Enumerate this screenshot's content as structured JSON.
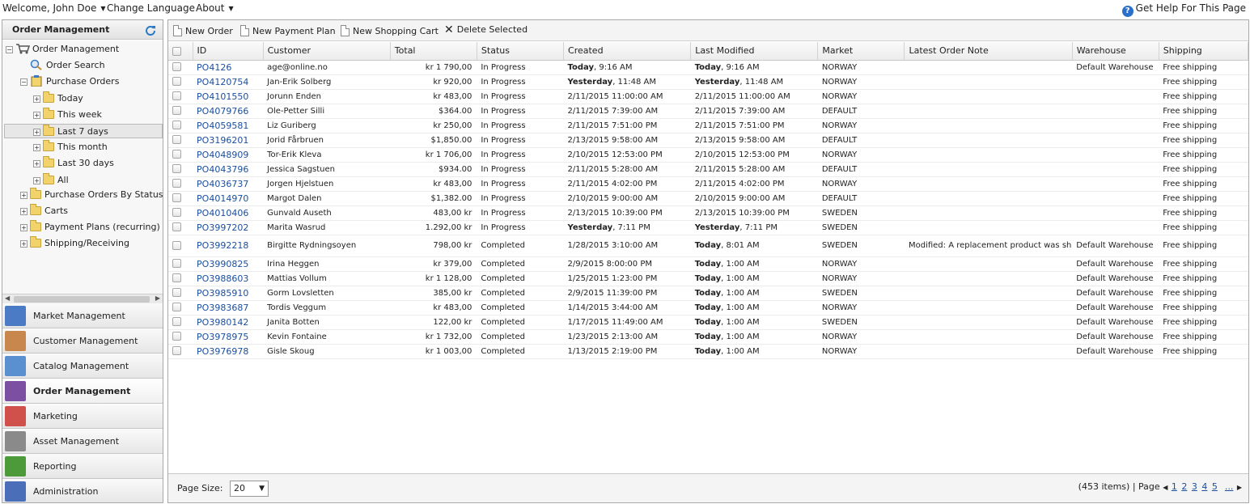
{
  "topbar": {
    "welcome": "Welcome, John Doe",
    "change_language": "Change Language",
    "about": "About",
    "help": "Get Help For This Page"
  },
  "left": {
    "title": "Order Management",
    "tree": [
      {
        "label": "Order Management"
      },
      {
        "label": "Order Search"
      },
      {
        "label": "Purchase Orders"
      },
      {
        "label": "Today"
      },
      {
        "label": "This week"
      },
      {
        "label": "Last 7 days"
      },
      {
        "label": "This month"
      },
      {
        "label": "Last 30 days"
      },
      {
        "label": "All"
      },
      {
        "label": "Purchase Orders By Status"
      },
      {
        "label": "Carts"
      },
      {
        "label": "Payment Plans (recurring)"
      },
      {
        "label": "Shipping/Receiving"
      }
    ],
    "modules": [
      {
        "label": "Market Management",
        "icon": "market-icon",
        "color": "#4a7bc4"
      },
      {
        "label": "Customer Management",
        "icon": "customers-icon",
        "color": "#c8874c"
      },
      {
        "label": "Catalog Management",
        "icon": "catalog-icon",
        "color": "#5a8fd0"
      },
      {
        "label": "Order Management",
        "icon": "cart-icon",
        "color": "#7d4fa3"
      },
      {
        "label": "Marketing",
        "icon": "marketing-icon",
        "color": "#d0504c"
      },
      {
        "label": "Asset Management",
        "icon": "asset-icon",
        "color": "#8a8a8a"
      },
      {
        "label": "Reporting",
        "icon": "report-icon",
        "color": "#4c9a3a"
      },
      {
        "label": "Administration",
        "icon": "admin-icon",
        "color": "#4a6fb8"
      }
    ]
  },
  "toolbar": {
    "new_order": "New Order",
    "new_payment_plan": "New Payment Plan",
    "new_shopping_cart": "New Shopping Cart",
    "delete_selected": "Delete Selected"
  },
  "grid": {
    "columns": [
      "ID",
      "Customer",
      "Total",
      "Status",
      "Created",
      "Last Modified",
      "Market",
      "Latest Order Note",
      "Warehouse",
      "Shipping"
    ],
    "rows": [
      {
        "id": "PO4126",
        "customer": "age@online.no",
        "total": "kr 1 790,00",
        "status": "In Progress",
        "created_b": "Today",
        "created": ", 9:16 AM",
        "modified_b": "Today",
        "modified": ", 9:16 AM",
        "market": "NORWAY",
        "note": "",
        "warehouse": "Default Warehouse",
        "shipping": "Free shipping"
      },
      {
        "id": "PO4120754",
        "customer": "Jan-Erik Solberg",
        "total": "kr 920,00",
        "status": "In Progress",
        "created_b": "Yesterday",
        "created": ", 11:48 AM",
        "modified_b": "Yesterday",
        "modified": ", 11:48 AM",
        "market": "NORWAY",
        "note": "",
        "warehouse": "",
        "shipping": "Free shipping"
      },
      {
        "id": "PO4101550",
        "customer": "Jorunn Enden",
        "total": "kr 483,00",
        "status": "In Progress",
        "created_b": "",
        "created": "2/11/2015 11:00:00 AM",
        "modified_b": "",
        "modified": "2/11/2015 11:00:00 AM",
        "market": "NORWAY",
        "note": "",
        "warehouse": "",
        "shipping": "Free shipping"
      },
      {
        "id": "PO4079766",
        "customer": "Ole-Petter Silli",
        "total": "$364.00",
        "status": "In Progress",
        "created_b": "",
        "created": "2/11/2015 7:39:00 AM",
        "modified_b": "",
        "modified": "2/11/2015 7:39:00 AM",
        "market": "DEFAULT",
        "note": "",
        "warehouse": "",
        "shipping": "Free shipping"
      },
      {
        "id": "PO4059581",
        "customer": "Liz Guriberg",
        "total": "kr 250,00",
        "status": "In Progress",
        "created_b": "",
        "created": "2/11/2015 7:51:00 PM",
        "modified_b": "",
        "modified": "2/11/2015 7:51:00 PM",
        "market": "NORWAY",
        "note": "",
        "warehouse": "",
        "shipping": "Free shipping"
      },
      {
        "id": "PO3196201",
        "customer": "Jorid Fårbruen",
        "total": "$1,850.00",
        "status": "In Progress",
        "created_b": "",
        "created": "2/13/2015 9:58:00 AM",
        "modified_b": "",
        "modified": "2/13/2015 9:58:00 AM",
        "market": "DEFAULT",
        "note": "",
        "warehouse": "",
        "shipping": "Free shipping"
      },
      {
        "id": "PO4048909",
        "customer": "Tor-Erik Kleva",
        "total": "kr 1 706,00",
        "status": "In Progress",
        "created_b": "",
        "created": "2/10/2015 12:53:00 PM",
        "modified_b": "",
        "modified": "2/10/2015 12:53:00 PM",
        "market": "NORWAY",
        "note": "",
        "warehouse": "",
        "shipping": "Free shipping"
      },
      {
        "id": "PO4043796",
        "customer": "Jessica Sagstuen",
        "total": "$934.00",
        "status": "In Progress",
        "created_b": "",
        "created": "2/11/2015 5:28:00 AM",
        "modified_b": "",
        "modified": "2/11/2015 5:28:00 AM",
        "market": "DEFAULT",
        "note": "",
        "warehouse": "",
        "shipping": "Free shipping"
      },
      {
        "id": "PO4036737",
        "customer": "Jorgen Hjelstuen",
        "total": "kr 483,00",
        "status": "In Progress",
        "created_b": "",
        "created": "2/11/2015 4:02:00 PM",
        "modified_b": "",
        "modified": "2/11/2015 4:02:00 PM",
        "market": "NORWAY",
        "note": "",
        "warehouse": "",
        "shipping": "Free shipping"
      },
      {
        "id": "PO4014970",
        "customer": "Margot Dalen",
        "total": "$1,382.00",
        "status": "In Progress",
        "created_b": "",
        "created": "2/10/2015 9:00:00 AM",
        "modified_b": "",
        "modified": "2/10/2015 9:00:00 AM",
        "market": "DEFAULT",
        "note": "",
        "warehouse": "",
        "shipping": "Free shipping"
      },
      {
        "id": "PO4010406",
        "customer": "Gunvald Auseth",
        "total": "483,00 kr",
        "status": "In Progress",
        "created_b": "",
        "created": "2/13/2015 10:39:00 PM",
        "modified_b": "",
        "modified": "2/13/2015 10:39:00 PM",
        "market": "SWEDEN",
        "note": "",
        "warehouse": "",
        "shipping": "Free shipping"
      },
      {
        "id": "PO3997202",
        "customer": "Marita Wasrud",
        "total": "1.292,00 kr",
        "status": "In Progress",
        "created_b": "Yesterday",
        "created": ", 7:11 PM",
        "modified_b": "Yesterday",
        "modified": ", 7:11 PM",
        "market": "SWEDEN",
        "note": "",
        "warehouse": "",
        "shipping": "Free shipping"
      },
      {
        "id": "PO3992218",
        "customer": "Birgitte Rydningsoyen",
        "total": "798,00 kr",
        "status": "Completed",
        "created_b": "",
        "created": "1/28/2015 3:10:00 AM",
        "modified_b": "Today",
        "modified": ", 8:01 AM",
        "market": "SWEDEN",
        "note": "Modified: A replacement product was shipped.",
        "warehouse": "Default Warehouse",
        "shipping": "Free shipping"
      },
      {
        "id": "PO3990825",
        "customer": "Irina Heggen",
        "total": "kr 379,00",
        "status": "Completed",
        "created_b": "",
        "created": "2/9/2015 8:00:00 PM",
        "modified_b": "Today",
        "modified": ", 1:00 AM",
        "market": "NORWAY",
        "note": "",
        "warehouse": "Default Warehouse",
        "shipping": "Free shipping"
      },
      {
        "id": "PO3988603",
        "customer": "Mattias Vollum",
        "total": "kr 1 128,00",
        "status": "Completed",
        "created_b": "",
        "created": "1/25/2015 1:23:00 PM",
        "modified_b": "Today",
        "modified": ", 1:00 AM",
        "market": "NORWAY",
        "note": "",
        "warehouse": "Default Warehouse",
        "shipping": "Free shipping"
      },
      {
        "id": "PO3985910",
        "customer": "Gorm Lovsletten",
        "total": "385,00 kr",
        "status": "Completed",
        "created_b": "",
        "created": "2/9/2015 11:39:00 PM",
        "modified_b": "Today",
        "modified": ", 1:00 AM",
        "market": "SWEDEN",
        "note": "",
        "warehouse": "Default Warehouse",
        "shipping": "Free shipping"
      },
      {
        "id": "PO3983687",
        "customer": "Tordis Veggum",
        "total": "kr 483,00",
        "status": "Completed",
        "created_b": "",
        "created": "1/14/2015 3:44:00 AM",
        "modified_b": "Today",
        "modified": ", 1:00 AM",
        "market": "NORWAY",
        "note": "",
        "warehouse": "Default Warehouse",
        "shipping": "Free shipping"
      },
      {
        "id": "PO3980142",
        "customer": "Janita Botten",
        "total": "122,00 kr",
        "status": "Completed",
        "created_b": "",
        "created": "1/17/2015 11:49:00 AM",
        "modified_b": "Today",
        "modified": ", 1:00 AM",
        "market": "SWEDEN",
        "note": "",
        "warehouse": "Default Warehouse",
        "shipping": "Free shipping"
      },
      {
        "id": "PO3978975",
        "customer": "Kevin Fontaine",
        "total": "kr 1 732,00",
        "status": "Completed",
        "created_b": "",
        "created": "1/23/2015 2:13:00 AM",
        "modified_b": "Today",
        "modified": ", 1:00 AM",
        "market": "NORWAY",
        "note": "",
        "warehouse": "Default Warehouse",
        "shipping": "Free shipping"
      },
      {
        "id": "PO3976978",
        "customer": "Gisle Skoug",
        "total": "kr 1 003,00",
        "status": "Completed",
        "created_b": "",
        "created": "1/13/2015 2:19:00 PM",
        "modified_b": "Today",
        "modified": ", 1:00 AM",
        "market": "NORWAY",
        "note": "",
        "warehouse": "Default Warehouse",
        "shipping": "Free shipping"
      }
    ]
  },
  "footer": {
    "page_size_label": "Page Size:",
    "page_size": "20",
    "items": "(453 items)",
    "page_label": "Page",
    "pages": [
      "1",
      "2",
      "3",
      "4",
      "5"
    ],
    "more": "..."
  }
}
